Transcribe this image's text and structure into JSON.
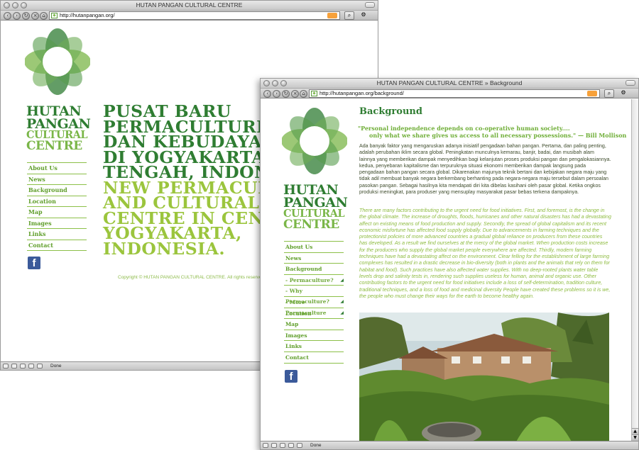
{
  "window1": {
    "title": "HUTAN PANGAN CULTURAL CENTRE",
    "url": "http://hutanpangan.org/",
    "status": "Done",
    "logo": {
      "line1": "HUTAN",
      "line2": "PANGAN",
      "line3": "CULTURAL",
      "line4": "CENTRE"
    },
    "nav": [
      "About Us",
      "News",
      "Background",
      "Location",
      "Map",
      "Images",
      "Links",
      "Contact"
    ],
    "headline_dark": [
      "PUSAT BARU",
      "PERMACULTURE",
      "DAN KEBUDAYAA",
      "DI YOGYAKARTA",
      "TENGAH, INDONE"
    ],
    "headline_light": [
      "NEW PERMACULT",
      "AND CULTURAL",
      "CENTRE IN CENT",
      "YOGYAKARTA,",
      "INDONESIA."
    ],
    "copyright": "Copyright © HUTAN PANGAN CULTURAL CENTRE. All rights reserved"
  },
  "window2": {
    "title": "HUTAN PANGAN CULTURAL CENTRE » Background",
    "url": "http://hutanpangan.org/background/",
    "status": "Done",
    "logo": {
      "line1": "HUTAN",
      "line2": "PANGAN",
      "line3": "CULTURAL",
      "line4": "CENTRE"
    },
    "nav": [
      {
        "label": "About Us",
        "sub": false
      },
      {
        "label": "News",
        "sub": false
      },
      {
        "label": "Background",
        "sub": false
      },
      {
        "label": "- Permaculture?",
        "sub": true
      },
      {
        "label": "- Why Permaculture?",
        "sub": true
      },
      {
        "label": "- More Permaculture",
        "sub": true
      },
      {
        "label": "Location",
        "sub": false
      },
      {
        "label": "Map",
        "sub": false
      },
      {
        "label": "Images",
        "sub": false
      },
      {
        "label": "Links",
        "sub": false
      },
      {
        "label": "Contact",
        "sub": false
      }
    ],
    "page_title": "Background",
    "quote_line1": "\"Personal independence depends on co-operative human society....",
    "quote_line2": "only what we share gives us access to all necessary possessions.\" — Bill Mollison",
    "body_id": "Ada banyak faktor yang mengaruskan adanya inisiatif pengadaan bahan pangan. Pertama, dan paling penting, adalah perubahan iklim secara global. Peningkatan munculnya kemarau, banjir, badai, dan musibah alam lainnya yang memberikan dampak menyedihkan bagi kelanjutan proses produksi pangan dan pengalokasiannya. kedua, penyebaran kapitalisme dan terpuruknya situasi ekonomi memberikan dampak langsung pada pengadaan bahan pangan secara global. Dikarenakan majunya teknik bertani dan kebijakan negara maju yang tidak adil membuat banyak negara berkembang berhanting pada negara-negara maju tersebut dalam persoalan pasokan pangan. Sebagai hasilnya kita mendapati diri kita dibelas kasihani oleh pasar global. Ketika ongkos produksi meningkat, para produser yang mensuplay masyarakat pasar bebas terkena dampaknya.",
    "body_en": "There are many factors contributing to the urgent need for food initiatives. First, and foremost, is the change in the global climate. The increase of droughts, floods, hurricanes and other natural disasters has had a devastating affect on existing means of food production and supply. Secondly, the spread of global capitalism and its recent economic misfortune has affected food supply globally. Due to advancements in farming techniques and the protectionist policies of more advanced countries a gradual global reliance on producers from these countries has developed. As a result we find ourselves at the mercy of the global market. When production costs increase for the producers who supply the global market people everywhere are affected. Thirdly, modern farming techniques have had a devastating affect on the environment. Clear felling for the establishment of large farming complexes has resulted in a drastic decrease in bio-diversity (both in plants and the animals that rely on them for habitat and food). Such practices have also affected water supplies. With no deep-rooted plants water table levels drop and salinity tests in, rendering such supplies useless for human, animal and organic use. Other contributing factors to the urgent need for food initiatives include a loss of self-determination, tradition culture, traditional techniques, and a loss of food and medicinal diversity People have created these problems so it is we, the people who must change their ways for the earth to become healthy again."
  },
  "colors": {
    "dark_green": "#2f7d32",
    "light_green": "#7ab648",
    "lime": "#9bc53d",
    "facebook": "#3b5a9a"
  },
  "icons": [
    "back-icon",
    "forward-icon",
    "reload-icon",
    "stop-icon",
    "home-icon",
    "rss-icon",
    "search-icon",
    "facebook-icon"
  ]
}
